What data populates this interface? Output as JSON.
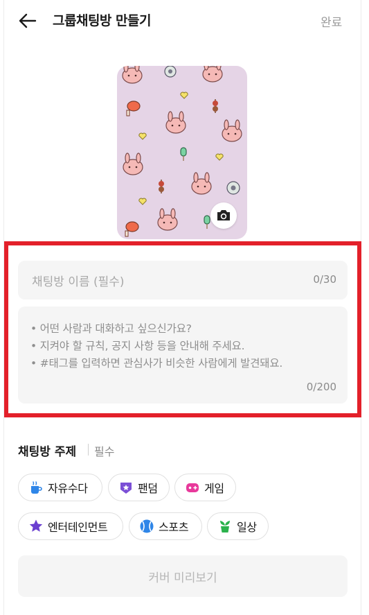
{
  "header": {
    "title": "그룹채팅방 만들기",
    "done_label": "완료"
  },
  "cover": {
    "background_color": "#e5d4e6",
    "camera_icon": "camera-icon"
  },
  "name_field": {
    "placeholder": "채팅방 이름 (필수)",
    "counter": "0/30"
  },
  "description_field": {
    "lines": [
      "• 어떤 사람과 대화하고 싶으신가요?",
      "• 지켜야 할 규칙, 공지 사항 등을 안내해 주세요.",
      "• #태그를 입력하면 관심사가 비슷한 사람에게 발견돼요."
    ],
    "counter": "0/200"
  },
  "topic": {
    "title": "채팅방 주제",
    "required": "필수",
    "chips": [
      {
        "label": "자유수다",
        "icon": "coffee-cup-icon",
        "color": "#2f86e8"
      },
      {
        "label": "팬덤",
        "icon": "heart-star-icon",
        "color": "#7b4fd6"
      },
      {
        "label": "게임",
        "icon": "gamepad-icon",
        "color": "#e8399b"
      },
      {
        "label": "엔터테인먼트",
        "icon": "star-icon",
        "color": "#6a3fd0"
      },
      {
        "label": "스포츠",
        "icon": "ball-icon",
        "color": "#2f86e8"
      },
      {
        "label": "일상",
        "icon": "plant-pot-icon",
        "color": "#2bb24c"
      }
    ]
  },
  "preview_button": {
    "label": "커버 미리보기"
  },
  "colors": {
    "highlight_border": "#e3202a",
    "field_background": "#f5f5f5"
  }
}
